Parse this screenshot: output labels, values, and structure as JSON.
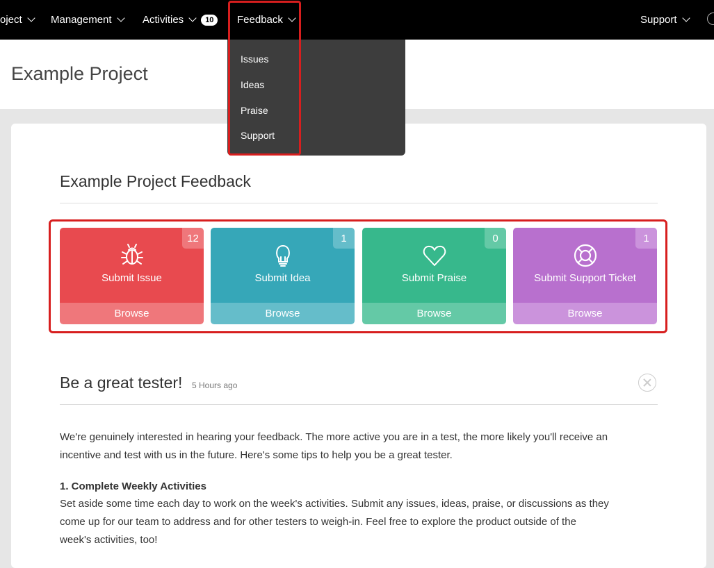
{
  "nav": {
    "items": [
      {
        "label": "oject"
      },
      {
        "label": "Management"
      },
      {
        "label": "Activities",
        "badge": "10"
      },
      {
        "label": "Feedback"
      },
      {
        "label": "Support"
      }
    ]
  },
  "dropdown": {
    "items": [
      "Issues",
      "Ideas",
      "Praise",
      "Support"
    ]
  },
  "page": {
    "title": "Example Project"
  },
  "feedback_section": {
    "title": "Example Project Feedback",
    "tiles": [
      {
        "label": "Submit Issue",
        "count": "12",
        "browse": "Browse",
        "icon": "bug-icon",
        "color": "#e84a4f",
        "bottom_color": "#ef777b",
        "badge_color": "#ef777b"
      },
      {
        "label": "Submit Idea",
        "count": "1",
        "browse": "Browse",
        "icon": "lightbulb-icon",
        "color": "#36a7b8",
        "bottom_color": "#65bdca",
        "badge_color": "#65bdca"
      },
      {
        "label": "Submit Praise",
        "count": "0",
        "browse": "Browse",
        "icon": "heart-icon",
        "color": "#37b88c",
        "bottom_color": "#64c9a6",
        "badge_color": "#64c9a6"
      },
      {
        "label": "Submit Support Ticket",
        "count": "1",
        "browse": "Browse",
        "icon": "lifebuoy-icon",
        "color": "#b870ce",
        "bottom_color": "#cb93dc",
        "badge_color": "#cb93dc"
      }
    ]
  },
  "post": {
    "title": "Be a great tester!",
    "time": "5 Hours ago",
    "paragraph1_line1": "We're genuinely interested in hearing your feedback.  The more active you are in a test, the more likely you'll receive an",
    "paragraph1_line2": "incentive and test with us in the future. Here's some tips to help you be a great tester.",
    "heading1": "1. Complete Weekly Activities",
    "paragraph2_line1": "Set aside some time each day to work on the week's activities. Submit any issues, ideas, praise, or discussions as they",
    "paragraph2_line2": "come up for our team to address and for other testers to weigh-in.  Feel free to explore the product outside of the",
    "paragraph2_line3": "week's activities, too!"
  },
  "colors": {
    "highlight": "#d71e1e",
    "nav_bg": "#000000",
    "dropdown_bg": "#3d3d3d"
  }
}
